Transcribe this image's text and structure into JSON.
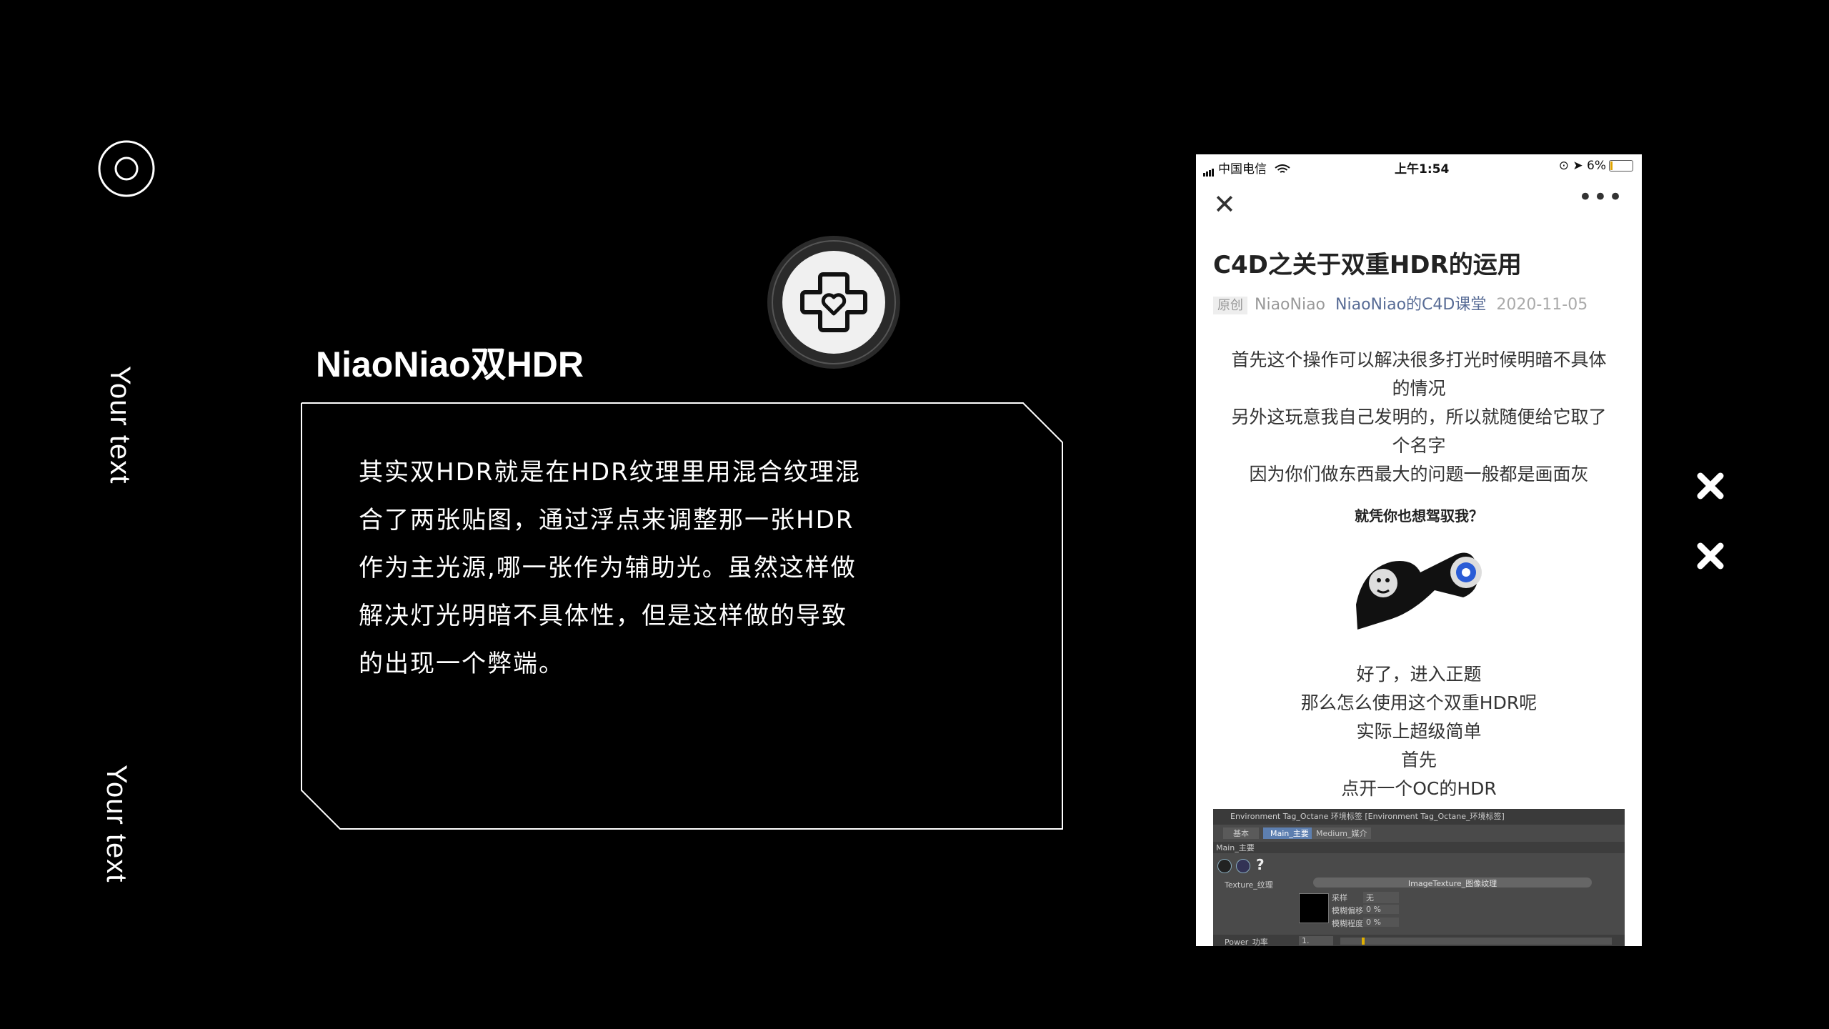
{
  "slide": {
    "vertical_text_1": "Your text",
    "vertical_text_2": "Your text",
    "heading": "NiaoNiao双HDR",
    "body_lines": [
      "其实双HDR就是在HDR纹理里用混合纹理混",
      "合了两张贴图，通过浮点来调整那一张HDR",
      "作为主光源,哪一张作为辅助光。虽然这样做",
      "解决灯光明暗不具体性，但是这样做的导致",
      "的出现一个弊端。"
    ],
    "icons": {
      "ring": "concentric-circle-icon",
      "badge": "medical-cross-heart-icon",
      "close_marks": "x-mark-icon"
    },
    "colors": {
      "background": "#000000",
      "foreground": "#ffffff",
      "link": "#576b95"
    }
  },
  "phone": {
    "status": {
      "carrier": "中国电信",
      "time": "上午1:54",
      "battery": "6%"
    },
    "article_title": "C4D之关于双重HDR的运用",
    "tag": "原创",
    "author": "NiaoNiao",
    "account": "NiaoNiao的C4D课堂",
    "date": "2020-11-05",
    "para1": [
      "首先这个操作可以解决很多打光时候明暗不具体",
      "的情况",
      "另外这玩意我自己发明的，所以就随便给它取了",
      "个名字",
      "因为你们做东西最大的问题一般都是画面灰"
    ],
    "meme_caption": "就凭你也想驾驭我？",
    "para2": [
      "好了，进入正题",
      "那么怎么使用这个双重HDR呢",
      "实际上超级简单",
      "首先",
      "点开一个OC的HDR"
    ],
    "oc_panel": {
      "title": "Environment Tag_Octane 环境标签 [Environment Tag_Octane_环境标签]",
      "tabs": [
        "基本",
        "Main_主要",
        "Medium_媒介"
      ],
      "section": "Main_主要",
      "texture_label": "Texture_纹理",
      "texture_value": "ImageTexture_图像纹理",
      "power_label": "Power_功率",
      "power_value": "1.",
      "fields": [
        {
          "label": "采样",
          "value": "无"
        },
        {
          "label": "模糊偏移",
          "value": "0 %"
        },
        {
          "label": "模糊程度",
          "value": "0 %"
        }
      ]
    }
  }
}
